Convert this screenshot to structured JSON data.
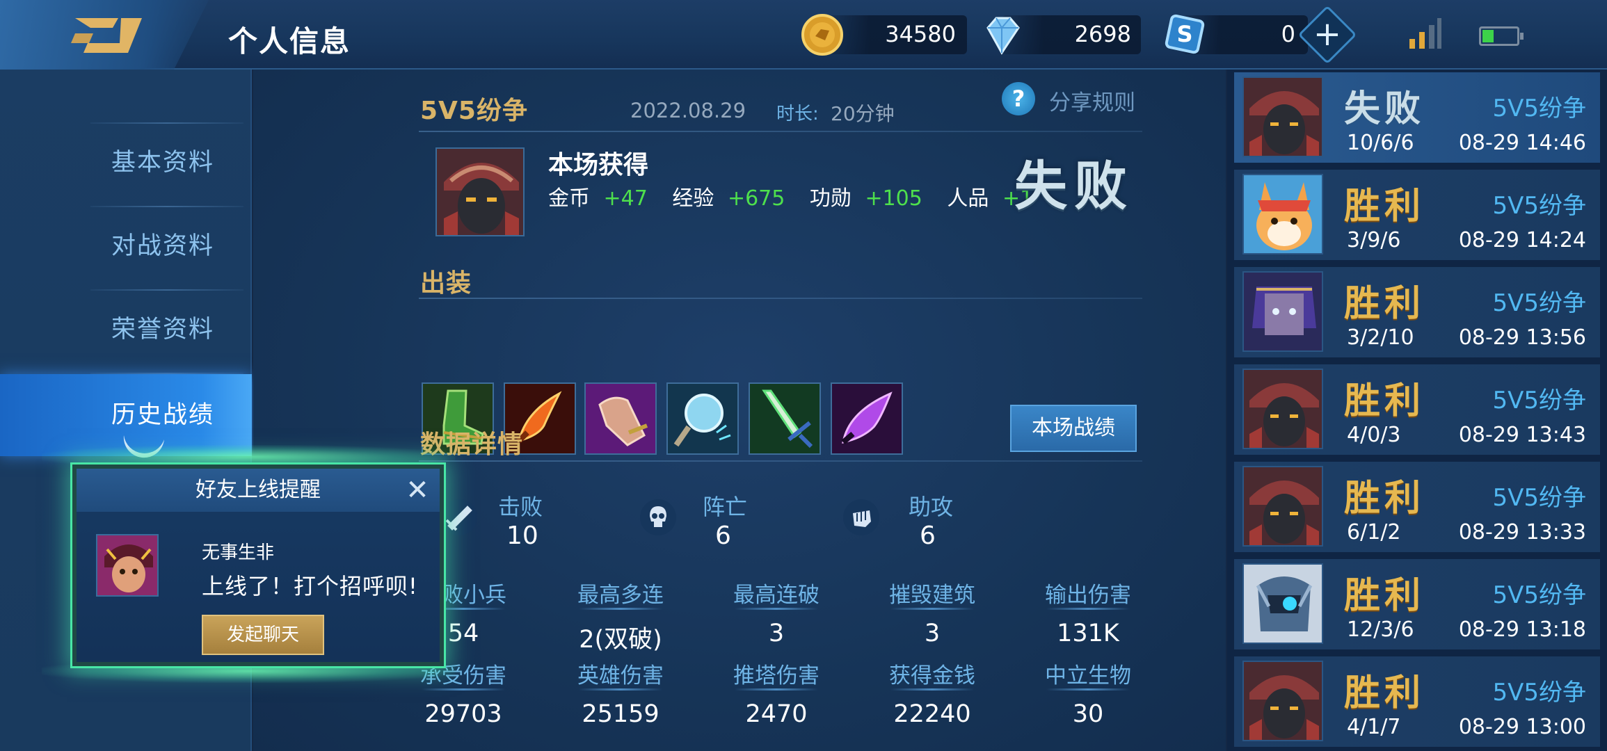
{
  "header": {
    "title": "个人信息",
    "gold": "34580",
    "diamonds": "2698",
    "coupons": "0",
    "plus_label": "+"
  },
  "sidebar": {
    "items": [
      {
        "label": "基本资料"
      },
      {
        "label": "对战资料"
      },
      {
        "label": "荣誉资料"
      },
      {
        "label": "历史战绩"
      }
    ]
  },
  "match": {
    "mode": "5V5纷争",
    "date": "2022.08.29",
    "duration_label": "时长:",
    "duration": "20分钟",
    "share_rules": "分享规则",
    "gain_title": "本场获得",
    "gains": [
      {
        "label": "金币",
        "value": "+47"
      },
      {
        "label": "经验",
        "value": "+675"
      },
      {
        "label": "功勋",
        "value": "+105"
      },
      {
        "label": "人品",
        "value": "+1"
      }
    ],
    "result": "失败",
    "equipment_title": "出装",
    "details_title": "数据详情",
    "details_button": "本场战绩",
    "kda": [
      {
        "label": "击败",
        "value": "10",
        "icon": "sword-icon"
      },
      {
        "label": "阵亡",
        "value": "6",
        "icon": "skull-icon"
      },
      {
        "label": "助攻",
        "value": "6",
        "icon": "fist-icon"
      }
    ],
    "stats_row1": [
      {
        "label": "击败小兵",
        "value": "54"
      },
      {
        "label": "最高多连",
        "value": "2(双破)"
      },
      {
        "label": "最高连破",
        "value": "3"
      },
      {
        "label": "摧毁建筑",
        "value": "3"
      },
      {
        "label": "输出伤害",
        "value": "131K"
      }
    ],
    "stats_row2": [
      {
        "label": "承受伤害",
        "value": "29703"
      },
      {
        "label": "英雄伤害",
        "value": "25159"
      },
      {
        "label": "推塔伤害",
        "value": "2470"
      },
      {
        "label": "获得金钱",
        "value": "22240"
      },
      {
        "label": "中立生物",
        "value": "30"
      }
    ]
  },
  "history": [
    {
      "result": "失败",
      "mode": "5V5纷争",
      "kda": "10/6/6",
      "time": "08-29 14:46"
    },
    {
      "result": "胜利",
      "mode": "5V5纷争",
      "kda": "3/9/6",
      "time": "08-29 14:24"
    },
    {
      "result": "胜利",
      "mode": "5V5纷争",
      "kda": "3/2/10",
      "time": "08-29 13:56"
    },
    {
      "result": "胜利",
      "mode": "5V5纷争",
      "kda": "4/0/3",
      "time": "08-29 13:43"
    },
    {
      "result": "胜利",
      "mode": "5V5纷争",
      "kda": "6/1/2",
      "time": "08-29 13:33"
    },
    {
      "result": "胜利",
      "mode": "5V5纷争",
      "kda": "12/3/6",
      "time": "08-29 13:18"
    },
    {
      "result": "胜利",
      "mode": "5V5纷争",
      "kda": "4/1/7",
      "time": "08-29 13:00"
    }
  ],
  "popup": {
    "title": "好友上线提醒",
    "close": "✕",
    "name": "无事生非",
    "message": "上线了！打个招呼呗!",
    "button": "发起聊天"
  },
  "colors": {
    "gold_text": "#d9b468",
    "gain_green": "#4ee04c",
    "accent_blue": "#52b8f2",
    "popup_glow": "#48e6a6"
  }
}
